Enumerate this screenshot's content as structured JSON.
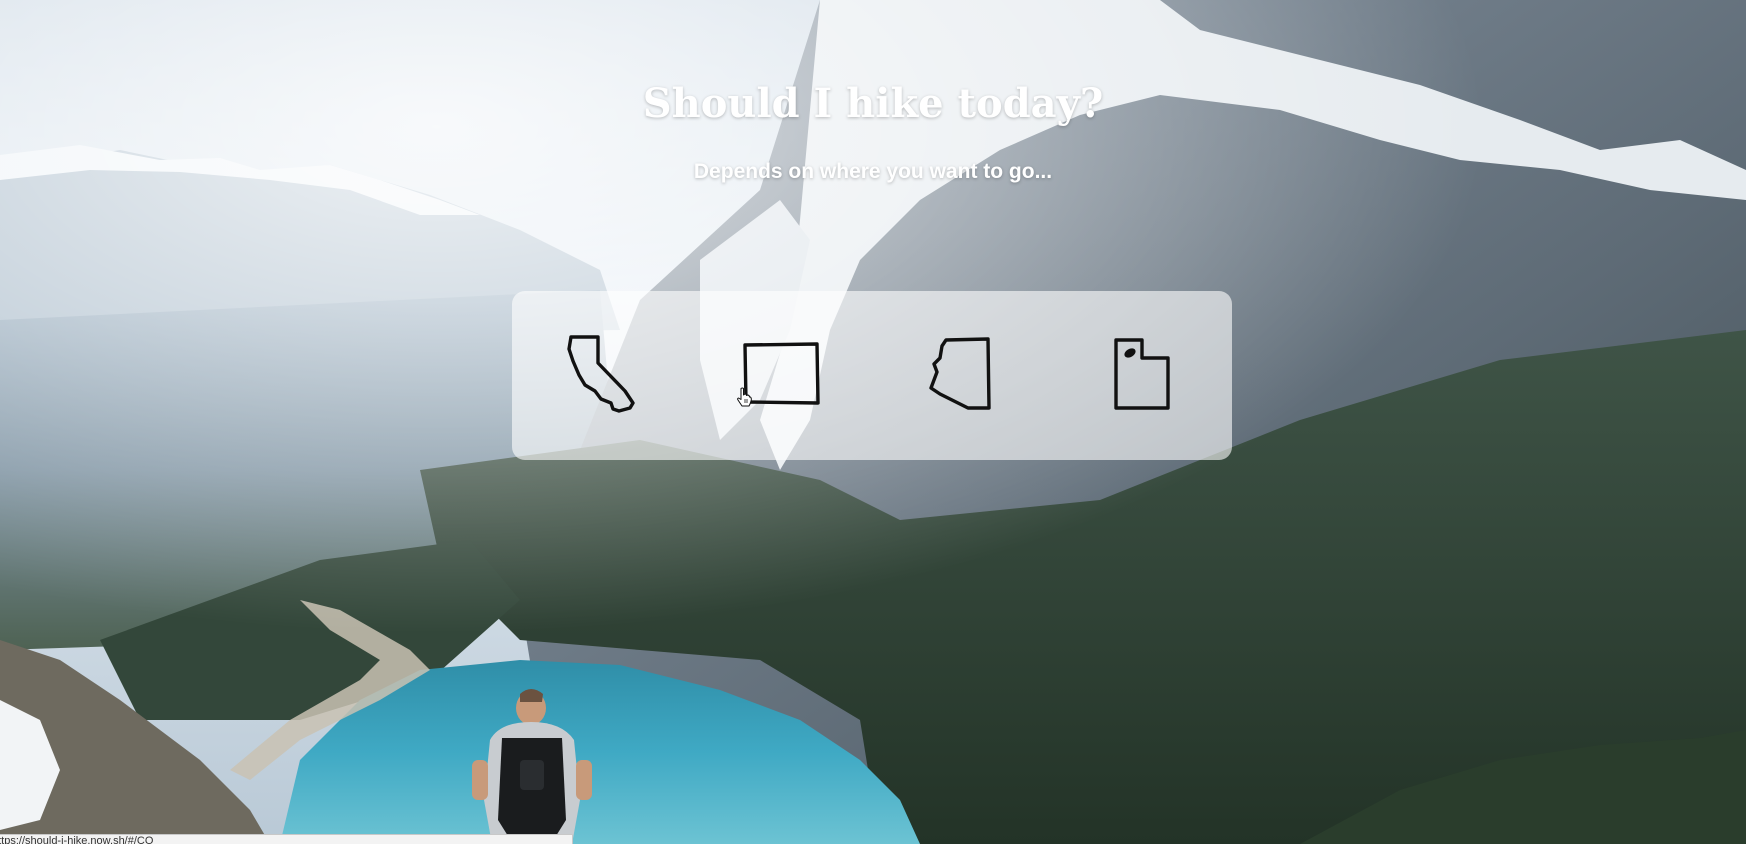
{
  "hero": {
    "title": "Should I hike today?",
    "subtitle": "Depends on where you want to go..."
  },
  "states": [
    {
      "name": "California",
      "icon": "california-outline-icon"
    },
    {
      "name": "Colorado",
      "icon": "colorado-outline-icon"
    },
    {
      "name": "Arizona",
      "icon": "arizona-outline-icon"
    },
    {
      "name": "Utah",
      "icon": "utah-outline-icon"
    }
  ],
  "status_bar": {
    "url": "https://should-i-hike.now.sh/#/CO"
  },
  "colors": {
    "title_text": "#ffffff",
    "panel_background": "rgba(255,255,255,0.6)",
    "state_outline": "#111111",
    "lake": "#3fa9c4",
    "sky": "#dbe7f0"
  }
}
